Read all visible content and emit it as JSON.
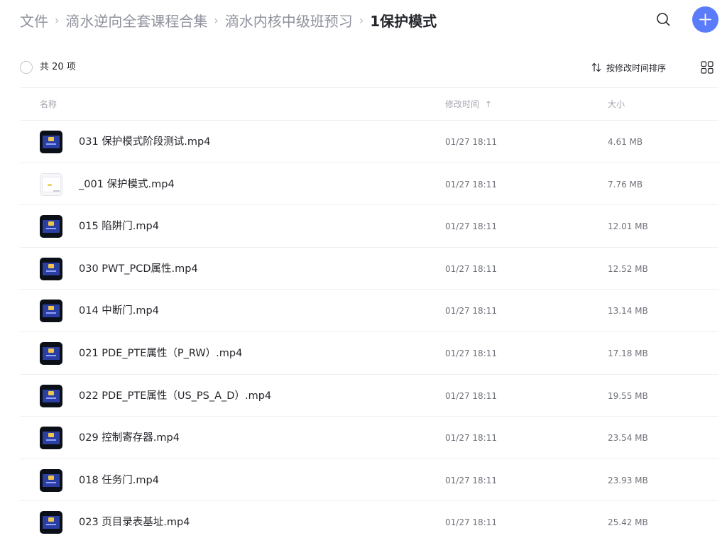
{
  "breadcrumb": {
    "items": [
      "文件",
      "滴水逆向全套课程合集",
      "滴水内核中级班预习"
    ],
    "current": "1保护模式",
    "separator": "›"
  },
  "toolbar": {
    "count_label": "共 20 项",
    "sort_label": "按修改时间排序"
  },
  "columns": {
    "name": "名称",
    "time": "修改时间",
    "time_sort_arrow": "↑",
    "size": "大小"
  },
  "colors": {
    "accent": "#5b7cfa"
  },
  "icons": {
    "search": "search-icon",
    "add": "plus-icon",
    "sort": "sort-arrows-icon",
    "grid": "grid-view-icon"
  },
  "files": [
    {
      "name": "031 保护模式阶段测试.mp4",
      "time": "01/27 18:11",
      "size": "4.61 MB",
      "thumb": "dark"
    },
    {
      "name": "_001 保护模式.mp4",
      "time": "01/27 18:11",
      "size": "7.76 MB",
      "thumb": "light"
    },
    {
      "name": "015 陷阱门.mp4",
      "time": "01/27 18:11",
      "size": "12.01 MB",
      "thumb": "dark"
    },
    {
      "name": "030 PWT_PCD属性.mp4",
      "time": "01/27 18:11",
      "size": "12.52 MB",
      "thumb": "dark"
    },
    {
      "name": "014 中断门.mp4",
      "time": "01/27 18:11",
      "size": "13.14 MB",
      "thumb": "dark"
    },
    {
      "name": "021 PDE_PTE属性（P_RW）.mp4",
      "time": "01/27 18:11",
      "size": "17.18 MB",
      "thumb": "dark"
    },
    {
      "name": "022 PDE_PTE属性（US_PS_A_D）.mp4",
      "time": "01/27 18:11",
      "size": "19.55 MB",
      "thumb": "dark"
    },
    {
      "name": "029 控制寄存器.mp4",
      "time": "01/27 18:11",
      "size": "23.54 MB",
      "thumb": "dark"
    },
    {
      "name": "018 任务门.mp4",
      "time": "01/27 18:11",
      "size": "23.93 MB",
      "thumb": "dark"
    },
    {
      "name": "023 页目录表基址.mp4",
      "time": "01/27 18:11",
      "size": "25.42 MB",
      "thumb": "dark"
    }
  ]
}
